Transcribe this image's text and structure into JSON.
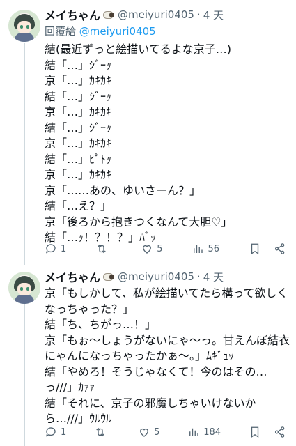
{
  "posts": [
    {
      "author": {
        "name": "メイちゃん",
        "emoji": "sheep-emoji",
        "handle": "@meiyuri0405",
        "time": "4 天"
      },
      "reply_label": "回覆給",
      "reply_handle": "@meiyuri0405",
      "lines": [
        "結(最近ずっと絵描いてるよな京子…)",
        "結「…」ｼﾞｰｯ",
        "京「…」ｶｷｶｷ",
        "結「…」ｼﾞｰｯ",
        "京「…」ｶｷｶｷ",
        "結「…」ｼﾞｰｯ",
        "京「…」ｶｷｶｷ",
        "結「…」ﾋﾟﾄｯ",
        "京「…」ｶｷｶｷ",
        "京「……あの、ゆいさーん？」",
        "結「…え？」",
        "京「後ろから抱きつくなんて大胆♡」",
        "結「…ｯ！？！？」ﾊﾞｯ"
      ],
      "stats": {
        "replies": "1",
        "reposts": "",
        "likes": "5",
        "views": "56"
      }
    },
    {
      "author": {
        "name": "メイちゃん",
        "emoji": "sheep-emoji",
        "handle": "@meiyuri0405",
        "time": "4 天"
      },
      "lines": [
        "京「もしかして、私が絵描いてたら構って欲しくなっちゃった？」",
        "結「ち、ちがっ…！」",
        "京「もぉ〜しょうがないにゃ〜っ。甘えんぼ結衣にゃんになっちゃったかぁ〜。」ﾑｷﾞｭｯ",
        "結「やめろ！そうじゃなくて！今のはその…っ///」ｶｧｧ",
        "結「それに、京子の邪魔しちゃいけないから…///」ｳﾙｳﾙ"
      ],
      "stats": {
        "replies": "1",
        "reposts": "",
        "likes": "5",
        "views": "184"
      }
    }
  ],
  "icons": {
    "reply": "speech-bubble-icon",
    "repost": "repost-arrows-icon",
    "like": "heart-icon",
    "views": "bar-chart-icon",
    "bookmark": "bookmark-icon",
    "share": "share-icon"
  },
  "colors": {
    "link": "#1d9bf0",
    "muted": "#536471",
    "text": "#0f1419"
  }
}
